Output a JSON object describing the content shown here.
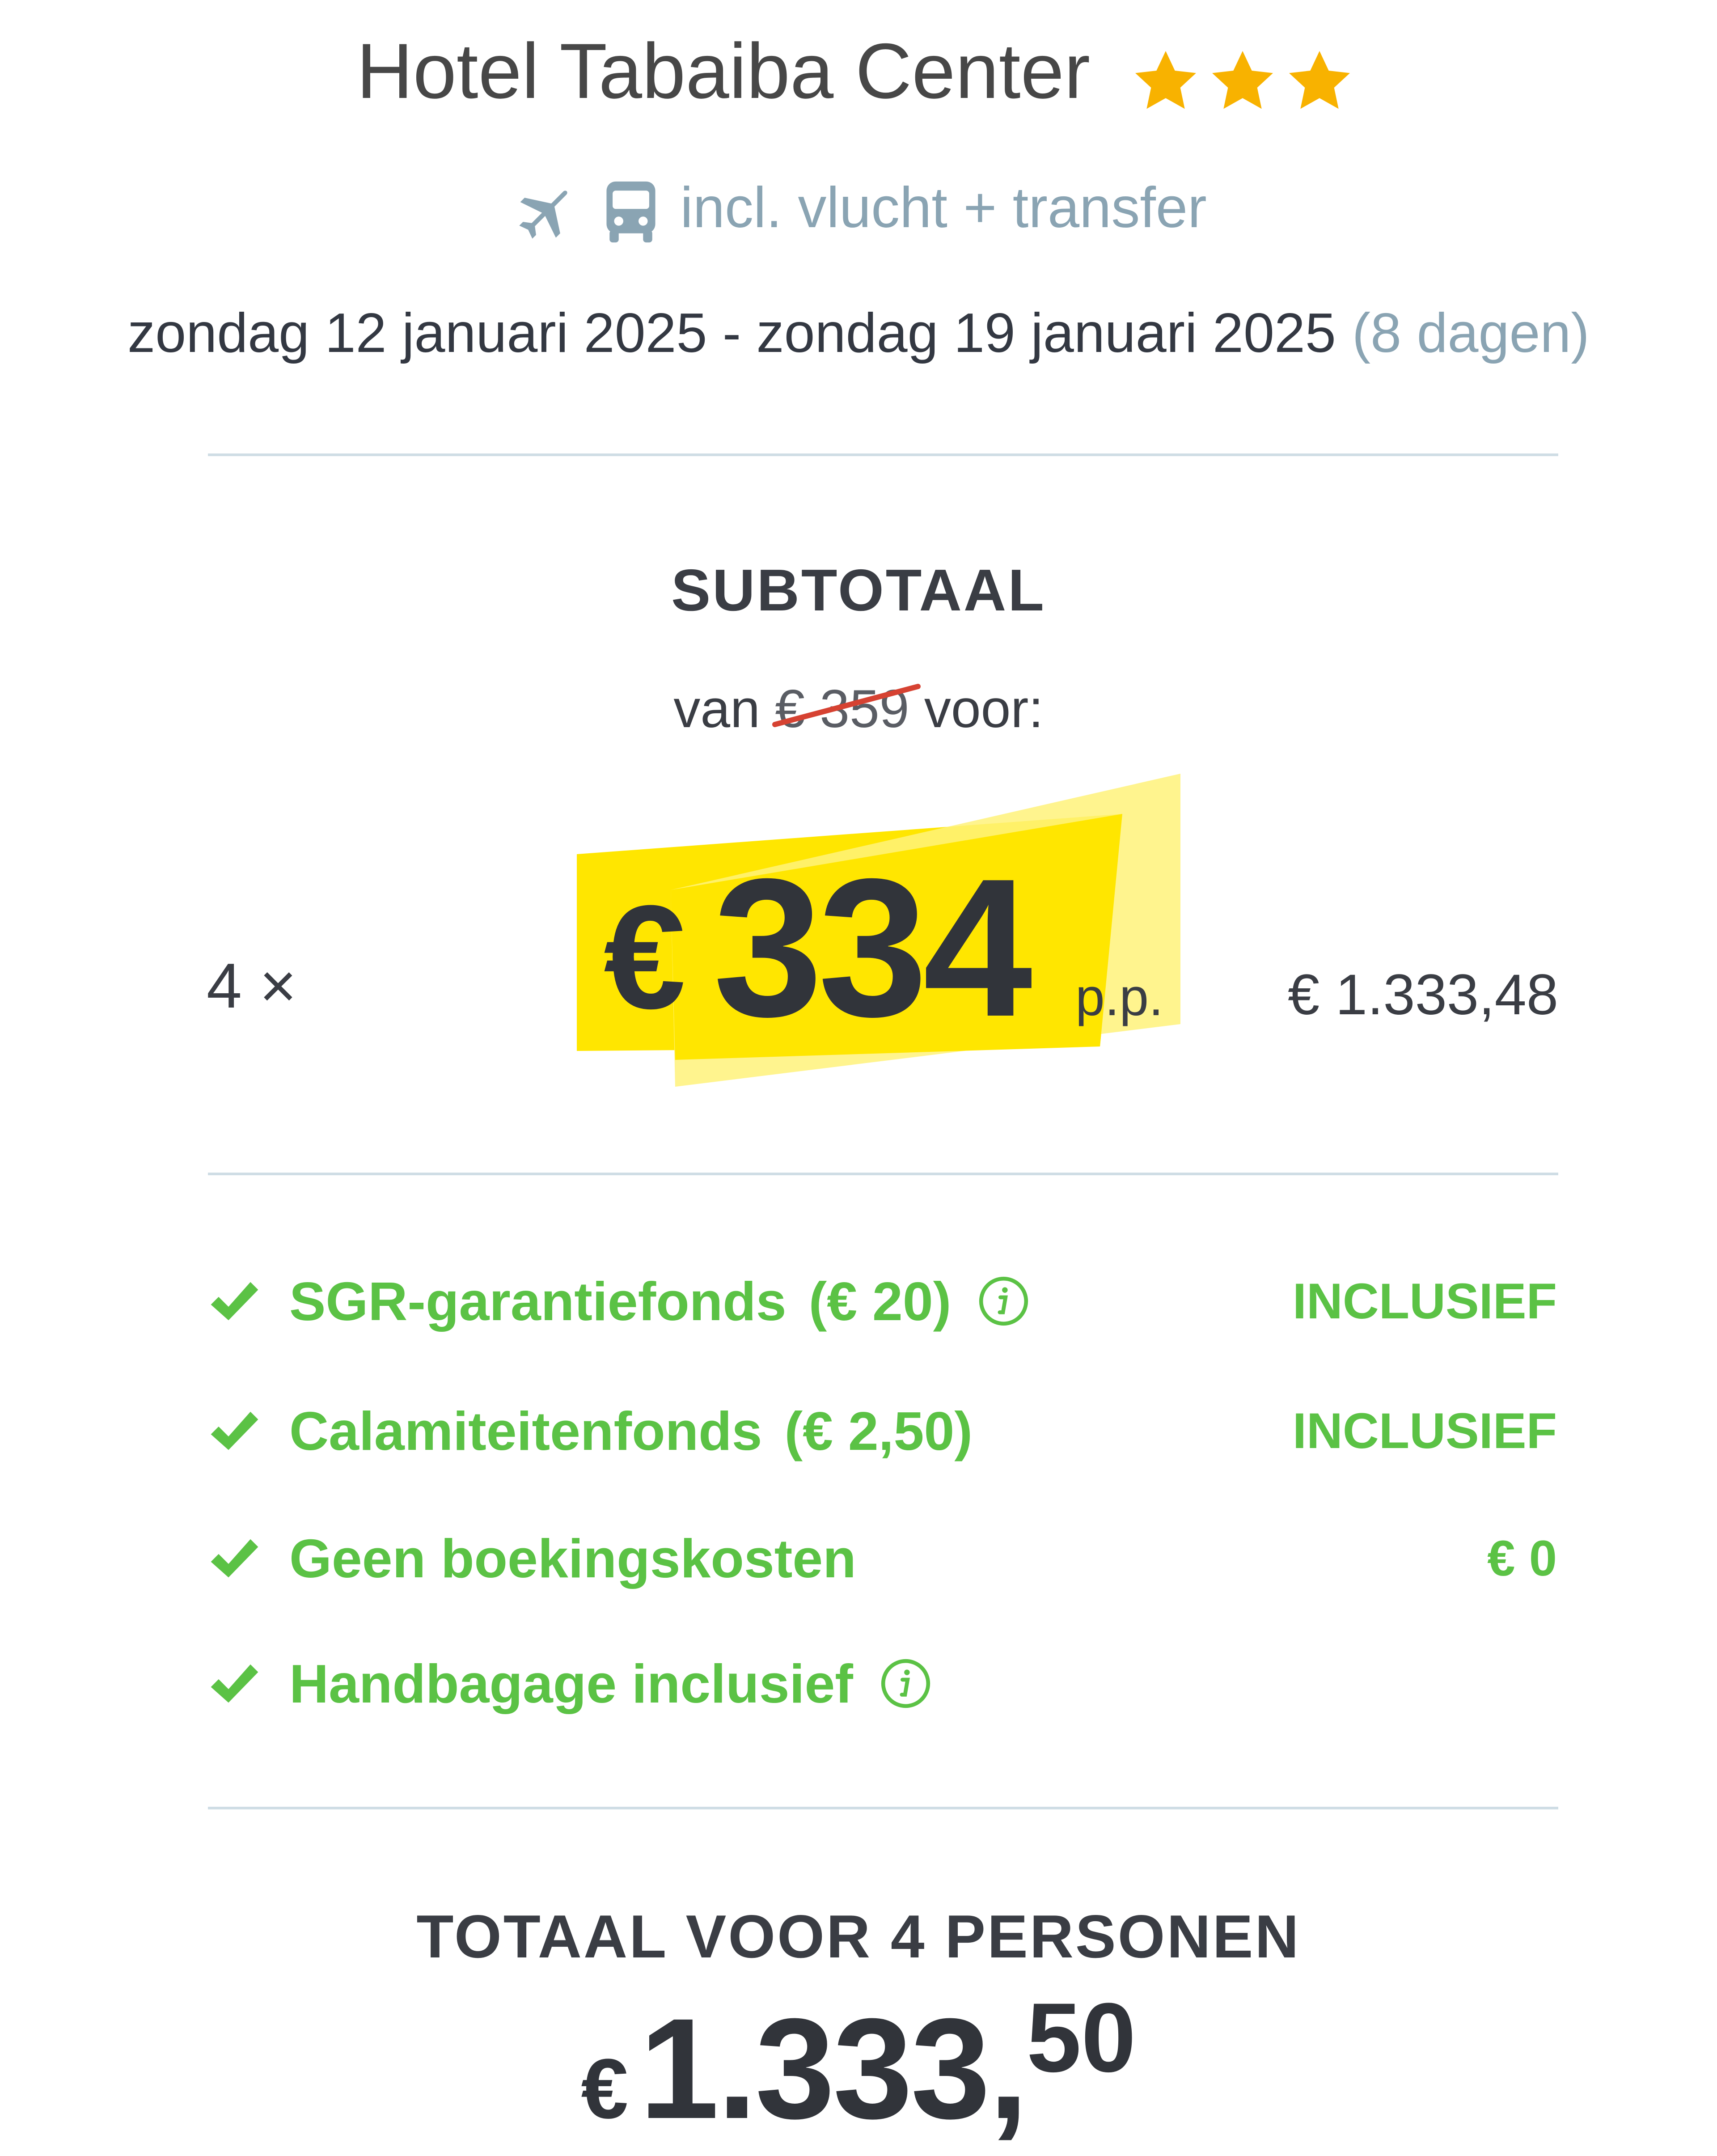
{
  "hotel": {
    "name": "Hotel Tabaiba Center",
    "stars": 3,
    "inclusions": "incl. vlucht + transfer",
    "date_range": "zondag 12 januari 2025 - zondag 19 januari 2025",
    "duration": "(8 dagen)"
  },
  "subtotal": {
    "heading": "SUBTOTAAL",
    "from_prefix": "van",
    "old_price": "€ 359",
    "from_suffix": "voor:",
    "quantity": "4 ×",
    "currency": "€",
    "price_per_person": "334",
    "per_person_label": "p.p.",
    "row_total": "€ 1.333,48"
  },
  "features": [
    {
      "label": "SGR-garantiefonds",
      "extra": "(€ 20)",
      "value": "INCLUSIEF",
      "has_info": true
    },
    {
      "label": "Calamiteitenfonds",
      "extra": "(€ 2,50)",
      "value": "INCLUSIEF",
      "has_info": false
    },
    {
      "label": "Geen boekingskosten",
      "extra": "",
      "value": "€ 0",
      "has_info": false
    },
    {
      "label": "Handbagage inclusief",
      "extra": "",
      "value": "",
      "has_info": true
    }
  ],
  "total": {
    "heading": "TOTAAL VOOR 4 PERSONEN",
    "currency": "€",
    "amount_main": "1.333,",
    "amount_cents": "50"
  },
  "colors": {
    "star": "#f8b200",
    "accent_green": "#5bc245",
    "muted_blue": "#8aa4b3",
    "highlight_yellow": "#ffe600",
    "strike_red": "#d64232"
  },
  "icons": [
    "star-icon",
    "airplane-icon",
    "bus-icon",
    "check-icon",
    "info-icon"
  ]
}
